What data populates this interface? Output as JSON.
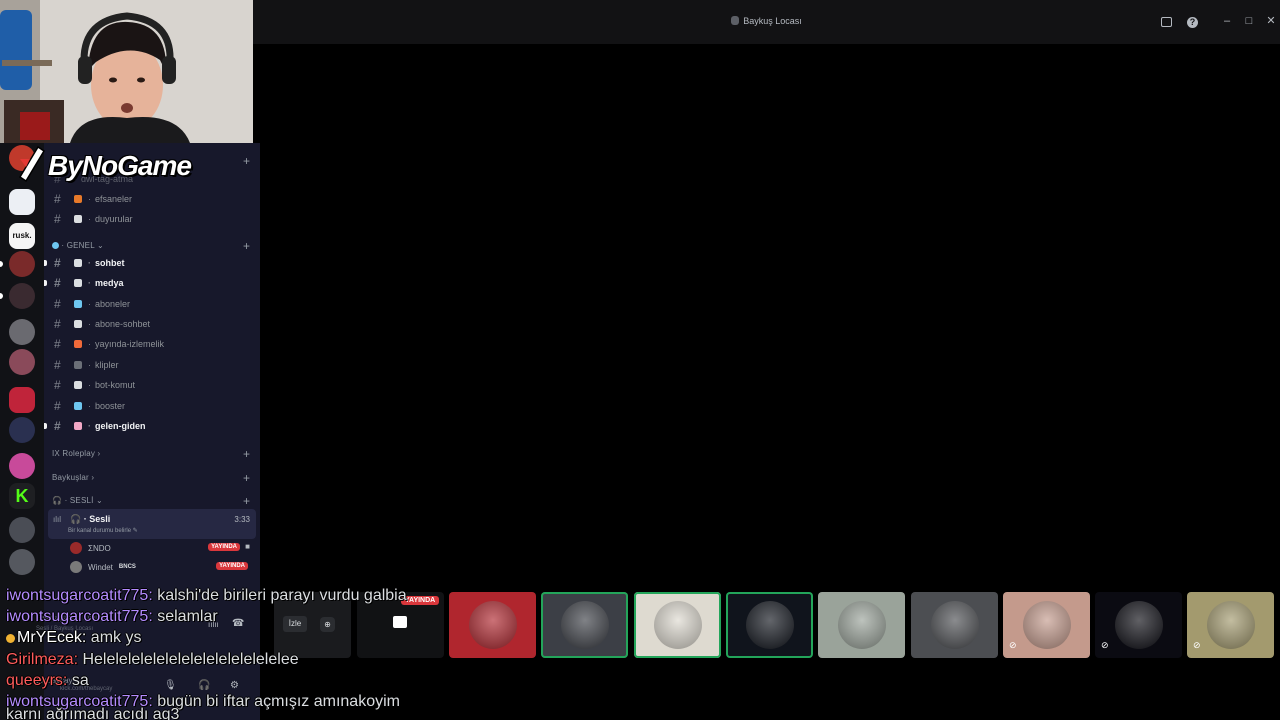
{
  "window": {
    "title": "Baykuş Locası"
  },
  "brand": {
    "logo_text": "ByNoGame"
  },
  "channels": {
    "top_partial": "dwl-tag-atma",
    "items_top": [
      {
        "name": "efsaneler",
        "emoji_color": "#e87a2a"
      },
      {
        "name": "duyurular",
        "emoji_color": "#dbdee1"
      }
    ],
    "genel": {
      "label": "GENEL",
      "items": [
        {
          "name": "sohbet",
          "bold": true,
          "emoji_color": "#dbdee1"
        },
        {
          "name": "medya",
          "bold": true,
          "emoji_color": "#dbdee1"
        },
        {
          "name": "aboneler",
          "bold": false,
          "emoji_color": "#6ec6f0"
        },
        {
          "name": "abone-sohbet",
          "bold": false,
          "emoji_color": "#dbdee1"
        },
        {
          "name": "yayında-izlemelik",
          "bold": false,
          "emoji_color": "#f06a3a"
        },
        {
          "name": "klipler",
          "bold": false,
          "emoji_color": "#6b6f78"
        },
        {
          "name": "bot-komut",
          "bold": false,
          "emoji_color": "#dbdee1"
        },
        {
          "name": "booster",
          "bold": false,
          "emoji_color": "#6ec6f0"
        },
        {
          "name": "gelen-giden",
          "bold": true,
          "emoji_color": "#f2a8c6"
        }
      ]
    },
    "categories": [
      "IX Roleplay",
      "Baykuşlar"
    ],
    "sesli": {
      "label": "SESLİ",
      "voice_channel": "Sesli",
      "voice_status": "Bir kanal durumu belirle",
      "timer": "3:33",
      "users": [
        {
          "name": "ΣNDO",
          "live": "YAYINDA",
          "avatar_color": "#9a2a2a"
        },
        {
          "name": "Windet",
          "tag": "BNCS",
          "live": "YAYINDA",
          "avatar_color": "#7a7a7a"
        }
      ]
    }
  },
  "voice_panel": {
    "status": "Ses Bağlantısı Kuruldu",
    "channel": "Sesli / Baykuş Locası",
    "stream_link": "kick.com/thebaycay",
    "username": "thebaycay"
  },
  "stream_strip": {
    "watch_label": "İzle",
    "live_badge": "YAYINDA",
    "tiles": [
      {
        "color": "#b0262e"
      },
      {
        "color": "#3c3f46",
        "speaking": true
      },
      {
        "color": "#dedad0",
        "speaking": true
      },
      {
        "color": "#10141c",
        "speaking": true
      },
      {
        "color": "#9aa39a"
      },
      {
        "color": "#4c4e52"
      },
      {
        "color": "#c49a8c",
        "muted": true
      },
      {
        "color": "#0b0b12",
        "muted": true
      },
      {
        "color": "#a39a6e",
        "muted": true
      }
    ]
  },
  "chat": [
    {
      "user": "iwontsugarcoatit775:",
      "text": " kalshi'de birileri parayı vurdu galbia"
    },
    {
      "user": "iwontsugarcoatit775:",
      "text": " selamlar"
    },
    {
      "user": "MrYEcek:",
      "text": " amk ys"
    },
    {
      "user": "Girilmeza:",
      "text": " Helelelelelelelelelelelelelelelee"
    },
    {
      "user": "queeyrs:",
      "text": " sa"
    },
    {
      "user": "iwontsugarcoatit775:",
      "text": " bugün bi iftar açmışız amınakoyim"
    },
    {
      "user": "",
      "text": "karnı ağrımadı acıdı aq3"
    }
  ]
}
